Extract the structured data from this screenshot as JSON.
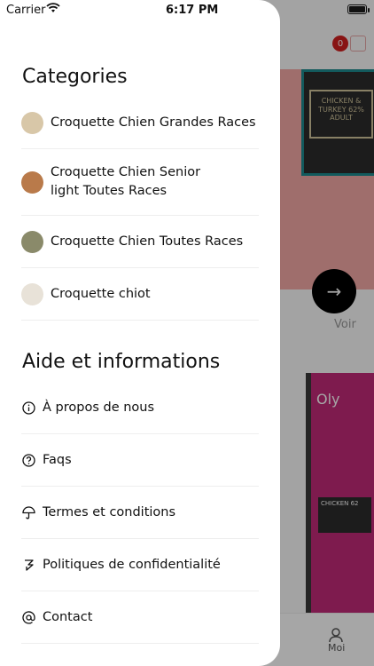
{
  "status_bar": {
    "carrier": "Carrier",
    "time": "6:17 PM"
  },
  "background": {
    "cart_count": "0",
    "product_label": "CHICKEN & TURKEY 62% ADULT",
    "voir_label": "Voir",
    "product2_label": "CHICKEN 62",
    "product2_brand": "Oly",
    "tab_moi": "Moi"
  },
  "drawer": {
    "categories_title": "Categories",
    "categories": [
      {
        "label": "Croquette Chien Grandes Races",
        "avatar_color": "#d8c7a8"
      },
      {
        "label": "Croquette Chien Senior light Toutes Races",
        "avatar_color": "#b97a4a"
      },
      {
        "label": "Croquette Chien Toutes Races",
        "avatar_color": "#8a8a6a"
      },
      {
        "label": "Croquette chiot",
        "avatar_color": "#e8e2d8"
      }
    ],
    "info_title": "Aide et informations",
    "info_items": [
      {
        "label": "À propos de nous",
        "icon": "info-icon"
      },
      {
        "label": "Faqs",
        "icon": "question-icon"
      },
      {
        "label": "Termes et conditions",
        "icon": "umbrella-icon"
      },
      {
        "label": "Politiques de confidentialité",
        "icon": "policy-icon"
      },
      {
        "label": "Contact",
        "icon": "at-icon"
      }
    ]
  }
}
